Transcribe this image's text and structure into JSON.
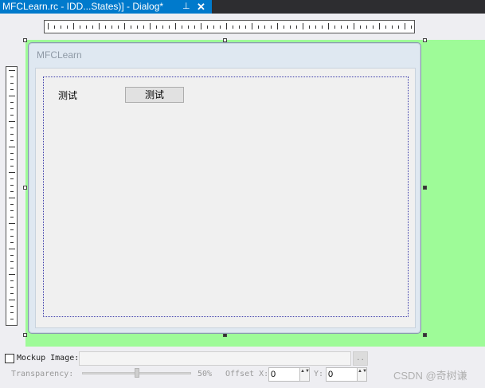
{
  "tab": {
    "title": "MFCLearn.rc - IDD...States)] - Dialog*",
    "pin_icon": "pin-icon",
    "close_icon": "close-icon",
    "pin_glyph": "⊥",
    "close_glyph": "✕"
  },
  "dialog": {
    "title": "MFCLearn",
    "static_text": "测试",
    "button_text": "测试"
  },
  "colors": {
    "tab_active": "#007acc",
    "tab_strip": "#2d2d30",
    "surface_background": "#9efb98",
    "guide_line": "#3a3aaa"
  },
  "bottom": {
    "mockup_label": "Mockup Image:",
    "mockup_checked": false,
    "mockup_value": "",
    "browse_label": "..",
    "transparency_label": "Transparency:",
    "transparency_value": "50%",
    "transparency_level": 0.5,
    "offset_x_label": "Offset X:",
    "offset_x_value": "0",
    "offset_y_label": "Y:",
    "offset_y_value": "0",
    "spin_glyph": "▲▼"
  },
  "watermark": "CSDN @奇树谦"
}
